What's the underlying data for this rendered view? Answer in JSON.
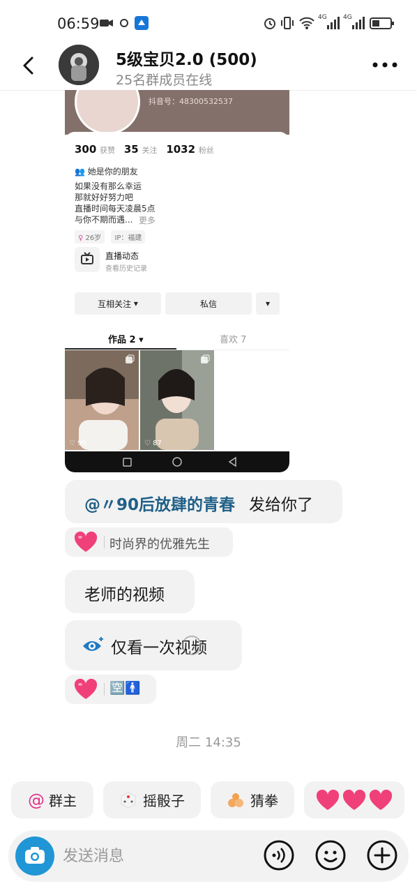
{
  "status_bar": {
    "time": "06:59",
    "network_1": "4G",
    "network_2": "4G"
  },
  "header": {
    "title": "5级宝贝2.0 (500)",
    "subtitle": "25名群成员在线"
  },
  "shared_screenshot": {
    "douyin_id": "抖音号：48300532537",
    "stats": [
      {
        "value": "300",
        "label": "获赞"
      },
      {
        "value": "35",
        "label": "关注"
      },
      {
        "value": "1032",
        "label": "粉丝"
      }
    ],
    "friend_note": "她是你的朋友",
    "bio": "如果没有那么幸运\n那就好好努力吧\n直播时间每天凌晨5点\n与你不期而遇...",
    "bio_more": "更多",
    "tags": [
      "26岁",
      "IP：福建"
    ],
    "live_title": "直播动态",
    "live_sub": "查看历史记录",
    "btn_follow": "互相关注",
    "btn_message": "私信",
    "tab_works": "作品 2",
    "tab_likes": "喜欢 7",
    "thumbs": [
      {
        "likes": "99"
      },
      {
        "likes": "87"
      }
    ]
  },
  "messages": [
    {
      "mention": "@〃90后放肆的青春",
      "text": "发给你了"
    },
    {
      "reaction_name": "时尚界的优雅先生"
    },
    {
      "text": "老师的视频"
    },
    {
      "text": "仅看一次视频"
    },
    {
      "reaction_name": "🈳🚹"
    }
  ],
  "date_separator": "周二 14:35",
  "quick_actions": [
    {
      "label": "群主"
    },
    {
      "label": "摇骰子"
    },
    {
      "label": "猜拳"
    }
  ],
  "input": {
    "placeholder": "发送消息"
  },
  "colors": {
    "accent_blue": "#2196d6",
    "mention_blue": "#1f5f87",
    "heart_pink": "#f0407a"
  }
}
